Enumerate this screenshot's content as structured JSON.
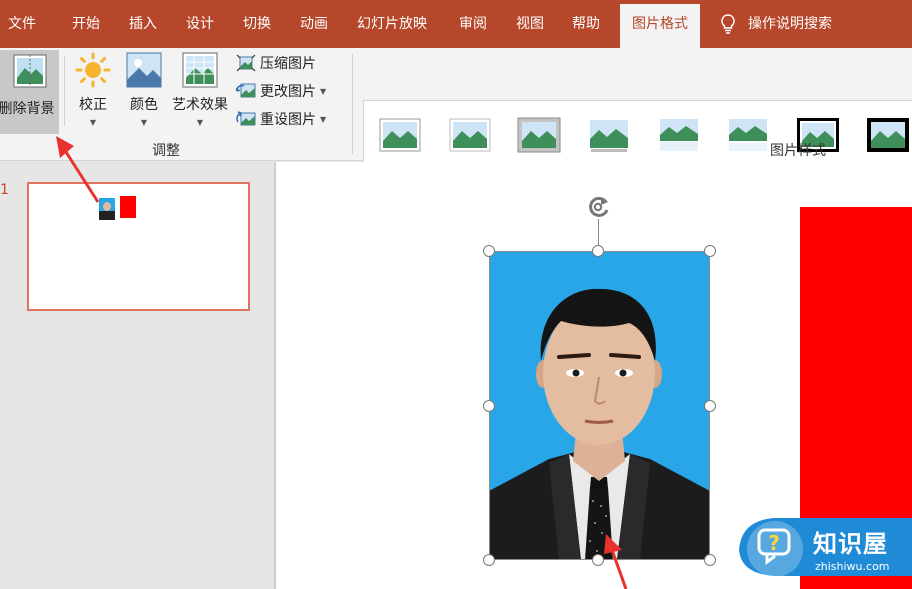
{
  "tabs": [
    {
      "label": "文件"
    },
    {
      "label": "开始"
    },
    {
      "label": "插入"
    },
    {
      "label": "设计"
    },
    {
      "label": "切换"
    },
    {
      "label": "动画"
    },
    {
      "label": "幻灯片放映"
    },
    {
      "label": "审阅"
    },
    {
      "label": "视图"
    },
    {
      "label": "帮助"
    },
    {
      "label": "图片格式"
    }
  ],
  "active_tab": "图片格式",
  "tell_me": "操作说明搜索",
  "ribbon": {
    "remove_bg": "删除背景",
    "corrections": "校正",
    "color": "颜色",
    "artistic": "艺术效果",
    "compress": "压缩图片",
    "change": "更改图片",
    "reset": "重设图片",
    "adjust_group": "调整",
    "styles_group": "图片样式"
  },
  "slide_pane": {
    "slide_number": "1"
  },
  "watermark": {
    "title": "知识屋",
    "url": "zhishiwu.com"
  },
  "colors": {
    "accent": "#b7472a",
    "slide_red": "#ff0000",
    "photo_bg": "#29a6e8",
    "annotation": "#e8322e"
  }
}
